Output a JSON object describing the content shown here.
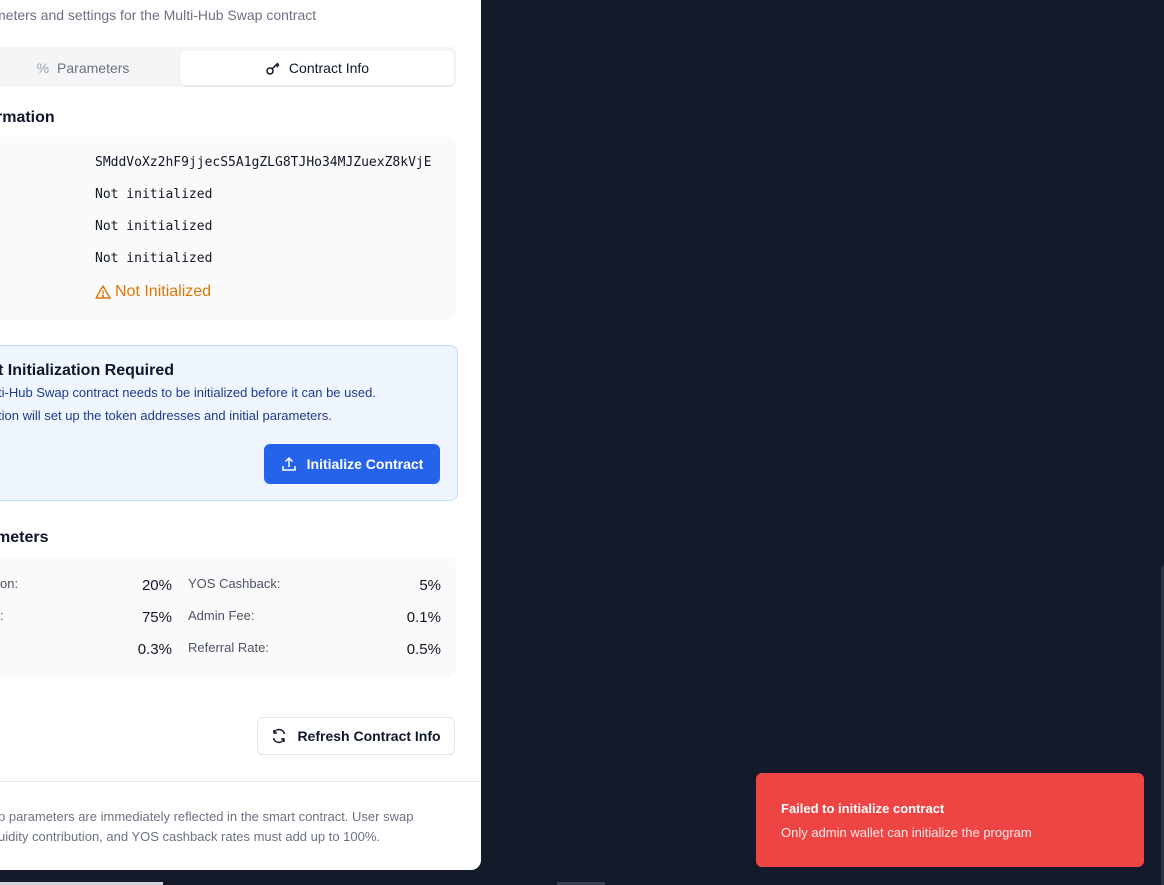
{
  "panel": {
    "subtitle": "meters and settings for the Multi-Hub Swap contract",
    "tabs": [
      {
        "label": "Parameters",
        "icon": "percent-icon"
      },
      {
        "label": "Contract Info",
        "icon": "key-icon"
      }
    ],
    "info": {
      "heading": "rmation",
      "program_id": "SMddVoXz2hF9jjecS5A1gZLG8TJHo34MJZuexZ8kVjE",
      "values": [
        "Not initialized",
        "Not initialized",
        "Not initialized"
      ],
      "status": "Not Initialized",
      "status_icon": "warning-icon",
      "status_color": "#d97706"
    },
    "init_box": {
      "title": "t Initialization Required",
      "line1": "ti-Hub Swap contract needs to be initialized before it can be used.",
      "line2": "tion will set up the token addresses and initial parameters.",
      "button_label": "Initialize Contract",
      "button_icon": "upload-icon",
      "accent": "#2563eb"
    },
    "params": {
      "heading": "meters",
      "left": [
        {
          "label": "on:",
          "value": "20%"
        },
        {
          "label": ":",
          "value": "75%"
        },
        {
          "label": "",
          "value": "0.3%"
        }
      ],
      "right": [
        {
          "label": "YOS Cashback:",
          "value": "5%"
        },
        {
          "label": "Admin Fee:",
          "value": "0.1%"
        },
        {
          "label": "Referral Rate:",
          "value": "0.5%"
        }
      ]
    },
    "refresh_label": "Refresh Contract Info",
    "refresh_icon": "refresh-icon",
    "footer_line1": "p parameters are immediately reflected in the smart contract. User swap",
    "footer_line2": "uidity contribution, and YOS cashback rates must add up to 100%."
  },
  "toast": {
    "title": "Failed to initialize contract",
    "message": "Only admin wallet can initialize the program",
    "color": "#ef4444"
  }
}
